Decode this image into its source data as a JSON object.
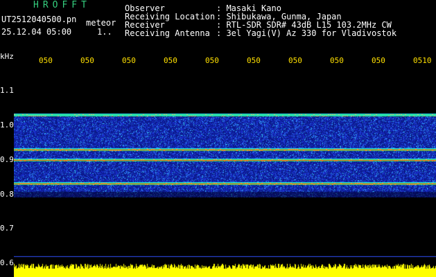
{
  "header": {
    "app_title": "HROFFT",
    "filename": "UT2512040500.pn",
    "meteor_label": "meteor",
    "datetime": "25.12.04 05:00",
    "count": "1.."
  },
  "station": {
    "fields": [
      {
        "label": "Observer",
        "value": ": Masaki Kano"
      },
      {
        "label": "Receiving Location",
        "value": ": Shibukawa, Gunma, Japan"
      },
      {
        "label": "Receiver",
        "value": ": RTL-SDR SDR# 43dB L15 103.2MHz CW"
      },
      {
        "label": "Receiving Antenna",
        "value": ": 3el Yagi(V) Az 330 for Vladivostok"
      }
    ]
  },
  "axis": {
    "y_unit": "kHz",
    "y_ticks": [
      "1.1",
      "1.0",
      "0.9",
      "0.8",
      "0.7",
      "0.6"
    ],
    "x_ticks": [
      "050",
      "050",
      "050",
      "050",
      "050",
      "050",
      "050",
      "050",
      "050",
      "0510"
    ]
  },
  "spectrogram": {
    "y_range_khz": [
      0.6,
      1.13
    ],
    "signal_band_khz": [
      0.79,
      1.03
    ],
    "line_freqs_khz": [
      1.03,
      0.93,
      0.9,
      0.83
    ],
    "colors": {
      "background": "#000000",
      "noise": "#1a2fd0",
      "band_edge": "#20c8ff",
      "carrier": "#ff3020",
      "carrier_halo": "#30ff60",
      "baseline": "#ffff00",
      "x_ticks": "#ffe000",
      "title": "#35d07f"
    }
  }
}
